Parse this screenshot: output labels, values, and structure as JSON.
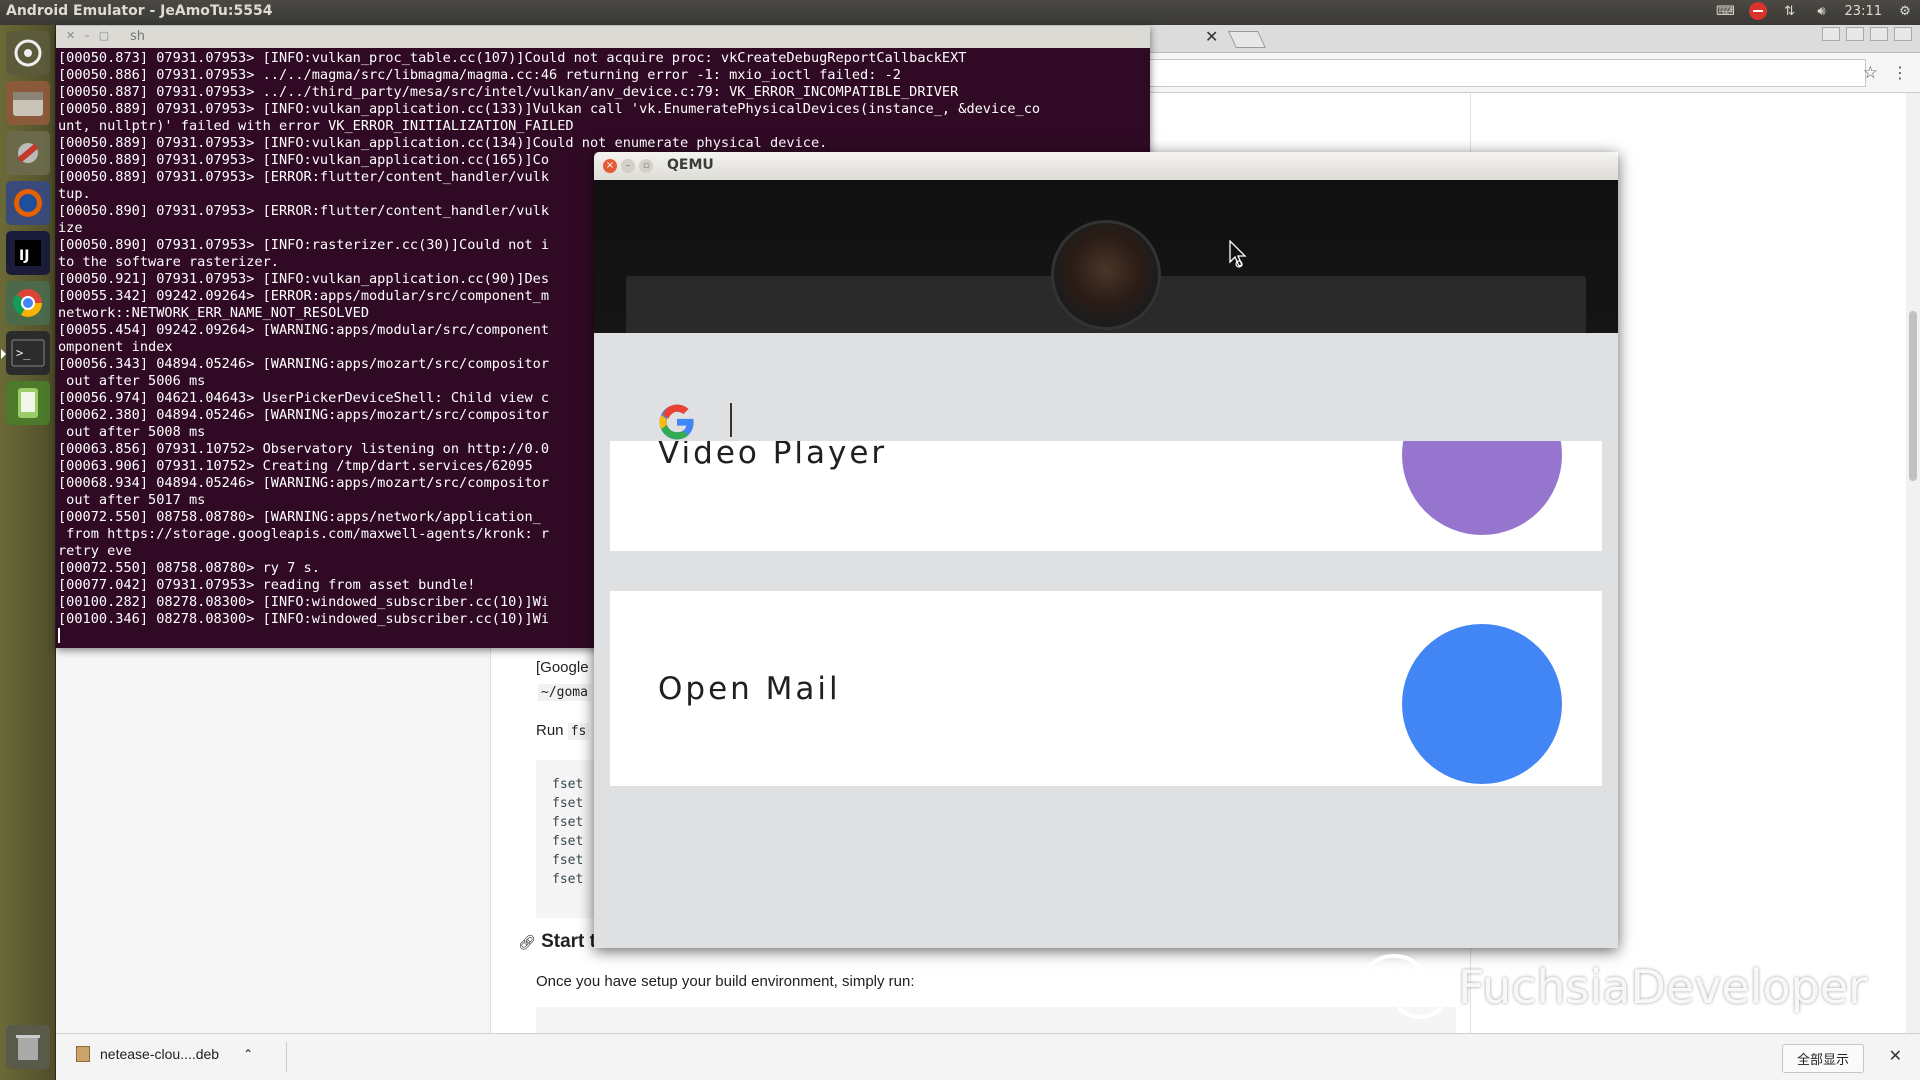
{
  "top_panel": {
    "title": "Android Emulator - JeAmoTu:5554",
    "time": "23:11"
  },
  "launcher": {
    "items": [
      "dash-icon",
      "files-icon",
      "settings-icon",
      "firefox-icon",
      "intellij-icon",
      "chrome-icon",
      "terminal-icon",
      "android-sdk-icon",
      "trash-icon"
    ]
  },
  "terminal": {
    "title": "sh",
    "lines": [
      "[00050.873] 07931.07953> [INFO:vulkan_proc_table.cc(107)]Could not acquire proc: vkCreateDebugReportCallbackEXT",
      "[00050.886] 07931.07953> ../../magma/src/libmagma/magma.cc:46 returning error -1: mxio_ioctl failed: -2",
      "[00050.887] 07931.07953> ../../third_party/mesa/src/intel/vulkan/anv_device.c:79: VK_ERROR_INCOMPATIBLE_DRIVER",
      "[00050.889] 07931.07953> [INFO:vulkan_application.cc(133)]Vulkan call 'vk.EnumeratePhysicalDevices(instance_, &device_co",
      "unt, nullptr)' failed with error VK_ERROR_INITIALIZATION_FAILED",
      "[00050.889] 07931.07953> [INFO:vulkan_application.cc(134)]Could not enumerate physical device.",
      "[00050.889] 07931.07953> [INFO:vulkan_application.cc(165)]Co",
      "[00050.889] 07931.07953> [ERROR:flutter/content_handler/vulk",
      "tup.",
      "[00050.890] 07931.07953> [ERROR:flutter/content_handler/vulk",
      "ize",
      "[00050.890] 07931.07953> [INFO:rasterizer.cc(30)]Could not i",
      "to the software rasterizer.",
      "[00050.921] 07931.07953> [INFO:vulkan_application.cc(90)]Des",
      "[00055.342] 09242.09264> [ERROR:apps/modular/src/component_m",
      "network::NETWORK_ERR_NAME_NOT_RESOLVED",
      "[00055.454] 09242.09264> [WARNING:apps/modular/src/component",
      "omponent index",
      "[00056.343] 04894.05246> [WARNING:apps/mozart/src/compositor",
      " out after 5006 ms",
      "[00056.974] 04621.04643> UserPickerDeviceShell: Child view c",
      "[00062.380] 04894.05246> [WARNING:apps/mozart/src/compositor",
      " out after 5008 ms",
      "[00063.856] 07931.10752> Observatory listening on http://0.0",
      "[00063.906] 07931.10752> Creating /tmp/dart.services/62095",
      "[00068.934] 04894.05246> [WARNING:apps/mozart/src/compositor",
      " out after 5017 ms",
      "[00072.550] 08758.08780> [WARNING:apps/network/application_",
      " from https://storage.googleapis.com/maxwell-agents/kronk: r",
      "retry eve",
      "[00072.550] 08758.08780> ry 7 s.",
      "[00077.042] 07931.07953> reading from asset bundle!",
      "[00100.282] 08278.08300> [INFO:windowed_subscriber.cc(10)]Wi",
      "[00100.346] 08278.08300> [INFO:windowed_subscriber.cc(10)]Wi"
    ]
  },
  "qemu": {
    "title": "QEMU",
    "search": {
      "value": ""
    },
    "cards": [
      {
        "label": "Video Player",
        "color": "#9575cd"
      },
      {
        "label": "Open Mail",
        "color": "#4285f4"
      }
    ]
  },
  "browser": {
    "doc": {
      "google_fragment": "[Google",
      "goma_fragment": "~/goma",
      "run_label": "Run",
      "run_code": "fs",
      "code_lines": [
        "fset",
        "fset",
        "fset",
        "fset",
        "fset",
        "fset"
      ],
      "heading_fragment": "Start t",
      "paragraph": "Once you have setup your build environment, simply run:"
    }
  },
  "download_bar": {
    "file": "netease-clou....deb",
    "show_all": "全部显示"
  },
  "watermark": {
    "text": "FuchsiaDeveloper"
  },
  "colors": {
    "terminal_bg": "#300a24",
    "accent_purple": "#9575cd",
    "accent_blue": "#4285f4"
  }
}
